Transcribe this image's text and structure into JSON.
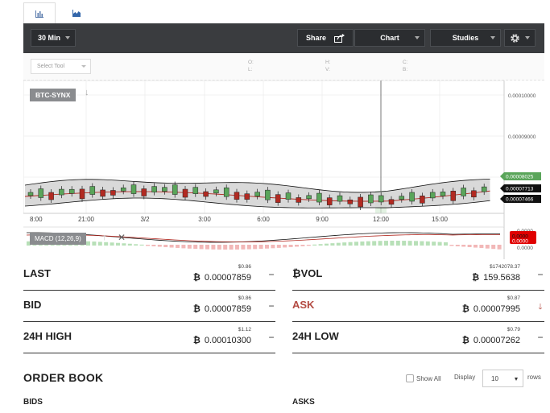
{
  "tabs": [
    {
      "icon": "bar-chart-icon",
      "active": true
    },
    {
      "icon": "area-chart-icon",
      "active": false
    }
  ],
  "toolbar": {
    "interval": "30 Min",
    "share_label": "Share",
    "chart_label": "Chart",
    "studies_label": "Studies"
  },
  "subbar": {
    "select_tool_placeholder": "Select Tool",
    "ohlc": {
      "o": "O:",
      "l": "L:",
      "h": "H:",
      "v": "V:",
      "c": "C:",
      "b": "B:"
    }
  },
  "chart": {
    "symbol": "BTC-SYNX",
    "macd_label": "MACD (12,26,9)",
    "price_ticks": [
      "0.00010000",
      "0.00009000"
    ],
    "time_ticks": [
      "8:00",
      "21:00",
      "3/2",
      "3:00",
      "6:00",
      "9:00",
      "12:00",
      "15:00"
    ],
    "price_tags": [
      {
        "label": "0.00008025",
        "color": "#5aa55a"
      },
      {
        "label": "0.00007713",
        "color": "#111111"
      },
      {
        "label": "0.00007466",
        "color": "#111111"
      }
    ],
    "macd_ticks": [
      "0.0000",
      "0.0000"
    ],
    "macd_tags": [
      "0.0000",
      "0.0000"
    ],
    "colors": {
      "up": "#5aa55a",
      "down": "#b22a22",
      "band": "#9a9a9a"
    }
  },
  "chart_data": {
    "type": "candlestick",
    "x_ticks": [
      "8:00",
      "21:00",
      "3/2",
      "3:00",
      "6:00",
      "9:00",
      "12:00",
      "15:00"
    ],
    "y_ticks": [
      0.0001,
      9e-05
    ],
    "last_price": 8.025e-05,
    "band_upper": 7.713e-05,
    "band_lower": 7.466e-05
  },
  "stats_left": [
    {
      "label": "LAST",
      "usd": "$0.86",
      "btc": "0.00007859",
      "toggle": "−"
    },
    {
      "label": "BID",
      "usd": "$0.86",
      "btc": "0.00007859",
      "toggle": "−"
    },
    {
      "label": "24H HIGH",
      "usd": "$1.12",
      "btc": "0.00010300",
      "toggle": "−"
    }
  ],
  "stats_right": [
    {
      "label": "₿VOL",
      "usd": "$1742078.37",
      "btc": "159.5638",
      "toggle": "−"
    },
    {
      "label": "ASK",
      "usd": "$0.87",
      "btc": "0.00007995",
      "toggle": "🡓"
    },
    {
      "label": "24H LOW",
      "usd": "$0.79",
      "btc": "0.00007262",
      "toggle": "−"
    }
  ],
  "btc_symbol": "₿",
  "orderbook": {
    "title": "ORDER BOOK",
    "show_all": "Show All",
    "display": "Display",
    "rows_value": "10",
    "rows_label": "rows",
    "bids": "BIDS",
    "asks": "ASKS"
  }
}
